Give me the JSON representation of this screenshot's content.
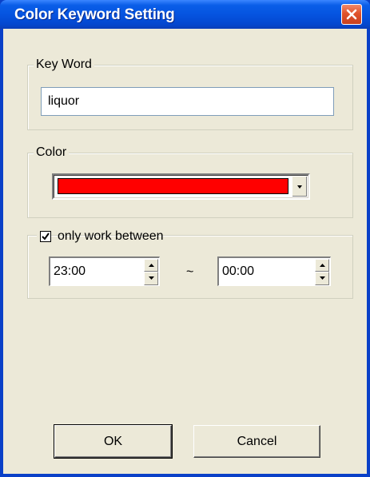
{
  "window": {
    "title": "Color Keyword Setting",
    "close_icon": "close-icon"
  },
  "keyword": {
    "group_label": "Key Word",
    "value": "liquor"
  },
  "color": {
    "group_label": "Color",
    "selected_color": "#ff0000",
    "dropdown_icon": "chevron-down-icon"
  },
  "schedule": {
    "checkbox_label": "only work between",
    "checked": true,
    "start_time": "23:00",
    "separator": "~",
    "end_time": "00:00"
  },
  "buttons": {
    "ok_label": "OK",
    "cancel_label": "Cancel"
  }
}
